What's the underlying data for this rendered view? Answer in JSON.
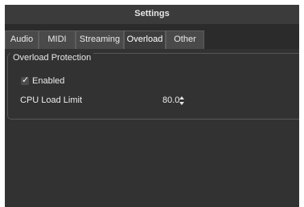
{
  "window": {
    "title": "Settings"
  },
  "tabs": [
    {
      "label": "Audio",
      "active": false
    },
    {
      "label": "MIDI",
      "active": false
    },
    {
      "label": "Streaming",
      "active": false
    },
    {
      "label": "Overload",
      "active": true
    },
    {
      "label": "Other",
      "active": false
    }
  ],
  "overload_protection": {
    "group_title": "Overload Protection",
    "enabled": {
      "label": "Enabled",
      "checked": true,
      "check_glyph": "✓"
    },
    "cpu_load_limit": {
      "label": "CPU Load Limit",
      "value": "80.0"
    }
  },
  "colors": {
    "window_background": "#2f2f30",
    "titlebar": "#3b3b3c",
    "tab_background": "#4a4a4b",
    "active_tab_background": "#3d3d3e",
    "text": "#ececec"
  }
}
